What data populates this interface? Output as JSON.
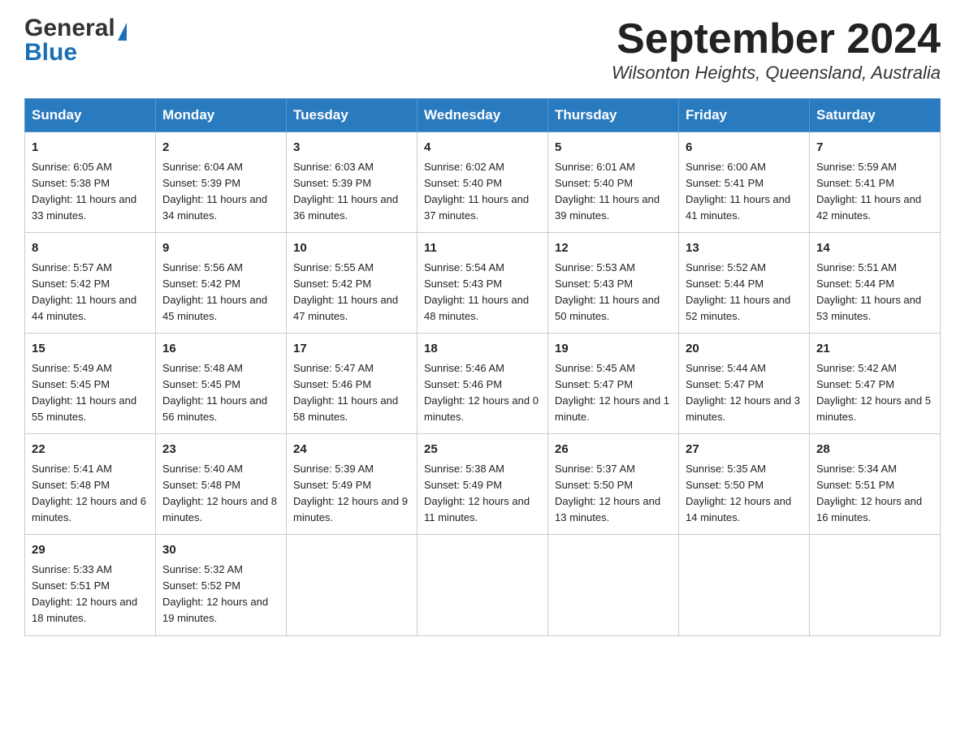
{
  "header": {
    "logo_general": "General",
    "logo_blue": "Blue",
    "month_title": "September 2024",
    "subtitle": "Wilsonton Heights, Queensland, Australia"
  },
  "weekdays": [
    "Sunday",
    "Monday",
    "Tuesday",
    "Wednesday",
    "Thursday",
    "Friday",
    "Saturday"
  ],
  "weeks": [
    [
      {
        "day": "1",
        "sunrise": "6:05 AM",
        "sunset": "5:38 PM",
        "daylight": "11 hours and 33 minutes."
      },
      {
        "day": "2",
        "sunrise": "6:04 AM",
        "sunset": "5:39 PM",
        "daylight": "11 hours and 34 minutes."
      },
      {
        "day": "3",
        "sunrise": "6:03 AM",
        "sunset": "5:39 PM",
        "daylight": "11 hours and 36 minutes."
      },
      {
        "day": "4",
        "sunrise": "6:02 AM",
        "sunset": "5:40 PM",
        "daylight": "11 hours and 37 minutes."
      },
      {
        "day": "5",
        "sunrise": "6:01 AM",
        "sunset": "5:40 PM",
        "daylight": "11 hours and 39 minutes."
      },
      {
        "day": "6",
        "sunrise": "6:00 AM",
        "sunset": "5:41 PM",
        "daylight": "11 hours and 41 minutes."
      },
      {
        "day": "7",
        "sunrise": "5:59 AM",
        "sunset": "5:41 PM",
        "daylight": "11 hours and 42 minutes."
      }
    ],
    [
      {
        "day": "8",
        "sunrise": "5:57 AM",
        "sunset": "5:42 PM",
        "daylight": "11 hours and 44 minutes."
      },
      {
        "day": "9",
        "sunrise": "5:56 AM",
        "sunset": "5:42 PM",
        "daylight": "11 hours and 45 minutes."
      },
      {
        "day": "10",
        "sunrise": "5:55 AM",
        "sunset": "5:42 PM",
        "daylight": "11 hours and 47 minutes."
      },
      {
        "day": "11",
        "sunrise": "5:54 AM",
        "sunset": "5:43 PM",
        "daylight": "11 hours and 48 minutes."
      },
      {
        "day": "12",
        "sunrise": "5:53 AM",
        "sunset": "5:43 PM",
        "daylight": "11 hours and 50 minutes."
      },
      {
        "day": "13",
        "sunrise": "5:52 AM",
        "sunset": "5:44 PM",
        "daylight": "11 hours and 52 minutes."
      },
      {
        "day": "14",
        "sunrise": "5:51 AM",
        "sunset": "5:44 PM",
        "daylight": "11 hours and 53 minutes."
      }
    ],
    [
      {
        "day": "15",
        "sunrise": "5:49 AM",
        "sunset": "5:45 PM",
        "daylight": "11 hours and 55 minutes."
      },
      {
        "day": "16",
        "sunrise": "5:48 AM",
        "sunset": "5:45 PM",
        "daylight": "11 hours and 56 minutes."
      },
      {
        "day": "17",
        "sunrise": "5:47 AM",
        "sunset": "5:46 PM",
        "daylight": "11 hours and 58 minutes."
      },
      {
        "day": "18",
        "sunrise": "5:46 AM",
        "sunset": "5:46 PM",
        "daylight": "12 hours and 0 minutes."
      },
      {
        "day": "19",
        "sunrise": "5:45 AM",
        "sunset": "5:47 PM",
        "daylight": "12 hours and 1 minute."
      },
      {
        "day": "20",
        "sunrise": "5:44 AM",
        "sunset": "5:47 PM",
        "daylight": "12 hours and 3 minutes."
      },
      {
        "day": "21",
        "sunrise": "5:42 AM",
        "sunset": "5:47 PM",
        "daylight": "12 hours and 5 minutes."
      }
    ],
    [
      {
        "day": "22",
        "sunrise": "5:41 AM",
        "sunset": "5:48 PM",
        "daylight": "12 hours and 6 minutes."
      },
      {
        "day": "23",
        "sunrise": "5:40 AM",
        "sunset": "5:48 PM",
        "daylight": "12 hours and 8 minutes."
      },
      {
        "day": "24",
        "sunrise": "5:39 AM",
        "sunset": "5:49 PM",
        "daylight": "12 hours and 9 minutes."
      },
      {
        "day": "25",
        "sunrise": "5:38 AM",
        "sunset": "5:49 PM",
        "daylight": "12 hours and 11 minutes."
      },
      {
        "day": "26",
        "sunrise": "5:37 AM",
        "sunset": "5:50 PM",
        "daylight": "12 hours and 13 minutes."
      },
      {
        "day": "27",
        "sunrise": "5:35 AM",
        "sunset": "5:50 PM",
        "daylight": "12 hours and 14 minutes."
      },
      {
        "day": "28",
        "sunrise": "5:34 AM",
        "sunset": "5:51 PM",
        "daylight": "12 hours and 16 minutes."
      }
    ],
    [
      {
        "day": "29",
        "sunrise": "5:33 AM",
        "sunset": "5:51 PM",
        "daylight": "12 hours and 18 minutes."
      },
      {
        "day": "30",
        "sunrise": "5:32 AM",
        "sunset": "5:52 PM",
        "daylight": "12 hours and 19 minutes."
      },
      null,
      null,
      null,
      null,
      null
    ]
  ]
}
